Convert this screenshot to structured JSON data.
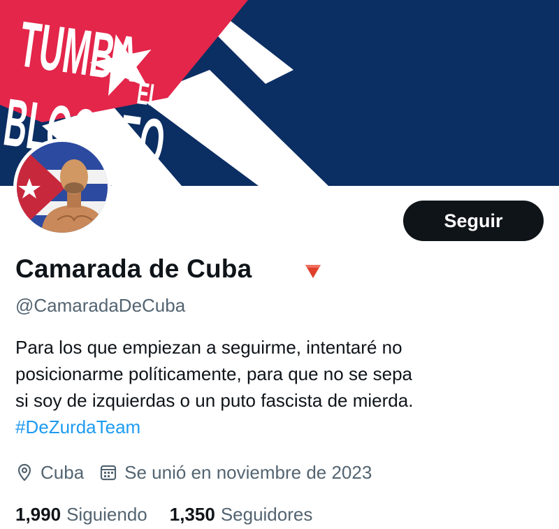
{
  "banner": {
    "text_line1": "TUMBA",
    "text_small": "EL",
    "text_line2": "BLOQUEO"
  },
  "profile": {
    "display_name": "Camarada de Cuba",
    "handle": "@CamaradaDeCuba",
    "bio_lines": [
      "Para los que empiezan a seguirme, intentaré no",
      "posicionarme políticamente, para que no se sepa",
      "si soy de izquierdas o un puto fascista de mierda."
    ],
    "hashtag": "#DeZurdaTeam",
    "location": "Cuba",
    "joined": "Se unió en noviembre de 2023",
    "following_count": "1,990",
    "following_label": "Siguiendo",
    "followers_count": "1,350",
    "followers_label": "Seguidores",
    "badge_icon": "red-triangle-down-icon"
  },
  "actions": {
    "follow_label": "Seguir"
  },
  "colors": {
    "banner_blue": "#0b2e63",
    "flag_red": "#e3264a",
    "follow_bg": "#0f1419",
    "link_blue": "#1d9bf0",
    "secondary_text": "#536471"
  }
}
